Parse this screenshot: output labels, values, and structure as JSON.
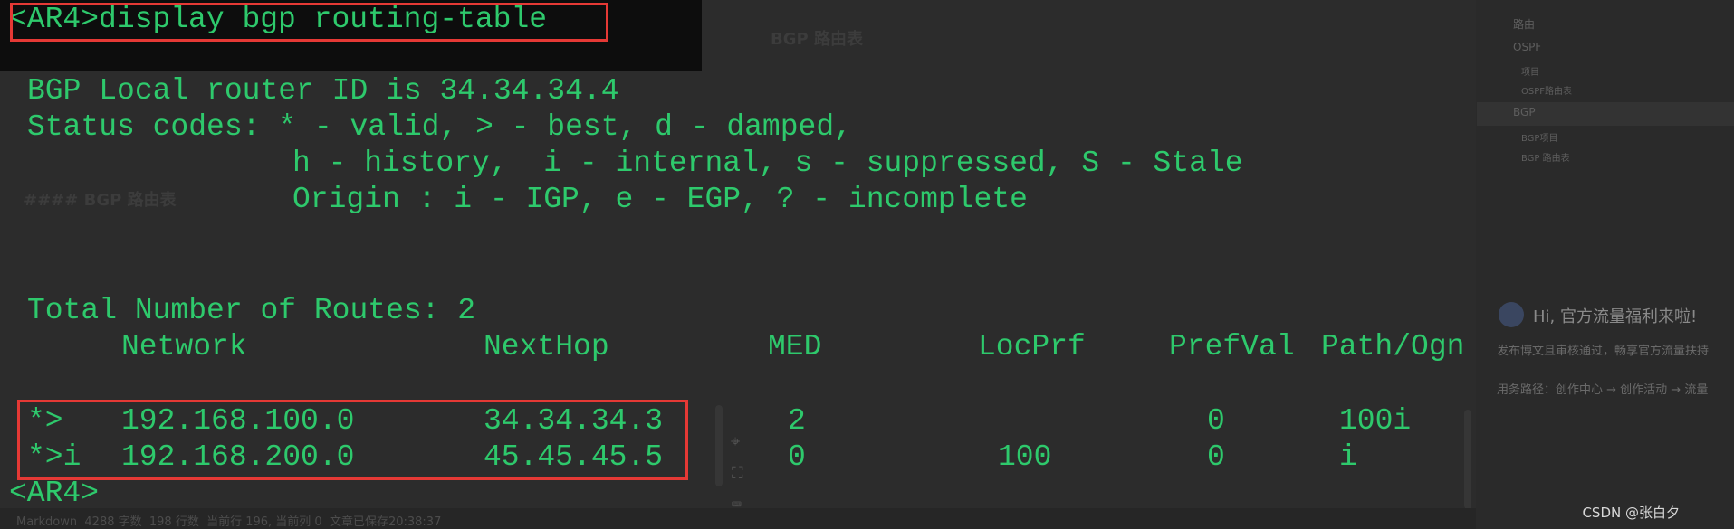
{
  "terminal": {
    "command": "<AR4>display bgp routing-table",
    "header": {
      "router_id": "BGP Local router ID is 34.34.34.4",
      "status_codes": "Status codes: * - valid, > - best, d - damped,",
      "status_codes_2": "h - history,  i - internal, s - suppressed, S - Stale",
      "origin": "Origin : i - IGP, e - EGP, ? - incomplete"
    },
    "total_routes": "Total Number of Routes: 2",
    "columns": {
      "network": "Network",
      "nexthop": "NextHop",
      "med": "MED",
      "locprf": "LocPrf",
      "prefval": "PrefVal",
      "path": "Path/Ogn"
    },
    "routes": [
      {
        "status": "*>",
        "network": "192.168.100.0",
        "nexthop": "34.34.34.3",
        "med": "2",
        "locprf": "",
        "prefval": "0",
        "path": "100i"
      },
      {
        "status": "*>i",
        "network": "192.168.200.0",
        "nexthop": "45.45.45.5",
        "med": "0",
        "locprf": "100",
        "prefval": "0",
        "path": "i"
      }
    ],
    "prompt": "<AR4>"
  },
  "background_doc": {
    "heading_center": "BGP 路由表",
    "heading_left": "#### BGP 路由表"
  },
  "toc": {
    "items": [
      "路由",
      "OSPF",
      "项目",
      "OSPF路由表",
      "BGP",
      "BGP项目",
      "BGP 路由表"
    ]
  },
  "promo": {
    "title": "Hi, 官方流量福利来啦!",
    "line1": "发布博文且审核通过，畅享官方流量扶持",
    "line2": "用务路径：创作中心 → 创作活动 → 流量"
  },
  "status_bar": {
    "text": "Markdown  4288 字数  198 行数  当前行 196, 当前列 0  文章已保存20:38:37"
  },
  "watermark": "CSDN @张白夕",
  "colors": {
    "terminal_green": "#2ec96c",
    "highlight_red": "#e53935",
    "background": "#2c2c2c"
  }
}
